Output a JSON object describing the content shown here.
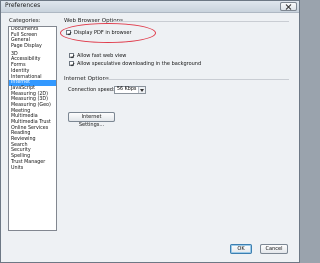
{
  "window": {
    "title": "Preferences"
  },
  "categories": {
    "label": "Categories:",
    "items": [
      {
        "label": "Documents"
      },
      {
        "label": "Full Screen"
      },
      {
        "label": "General"
      },
      {
        "label": "Page Display"
      },
      {
        "label": ""
      },
      {
        "label": "3D"
      },
      {
        "label": "Accessibility"
      },
      {
        "label": "Forms"
      },
      {
        "label": "Identity"
      },
      {
        "label": "International"
      },
      {
        "label": "Internet",
        "selected": true
      },
      {
        "label": "JavaScript"
      },
      {
        "label": "Measuring (2D)"
      },
      {
        "label": "Measuring (3D)"
      },
      {
        "label": "Measuring (Geo)"
      },
      {
        "label": "Meeting"
      },
      {
        "label": "Multimedia"
      },
      {
        "label": "Multimedia Trust"
      },
      {
        "label": "Online Services"
      },
      {
        "label": "Reading"
      },
      {
        "label": "Reviewing"
      },
      {
        "label": "Search"
      },
      {
        "label": "Security"
      },
      {
        "label": "Spelling"
      },
      {
        "label": "Trust Manager"
      },
      {
        "label": "Units"
      }
    ]
  },
  "web_browser_options": {
    "heading": "Web Browser Options",
    "display_pdf": {
      "label": "Display PDF in browser",
      "checked": true
    },
    "fast_web_view": {
      "label": "Allow fast web view",
      "checked": true
    },
    "speculative_downloading": {
      "label": "Allow speculative downloading in the background",
      "checked": true
    }
  },
  "internet_options": {
    "heading": "Internet Options",
    "connection_speed_label": "Connection speed:",
    "connection_speed_value": "56 Kbps",
    "settings_button": "Internet Settings..."
  },
  "footer": {
    "ok_label": "OK",
    "cancel_label": "Cancel"
  },
  "colors": {
    "highlight_circle": "#e03a4a",
    "selection": "#3399ff"
  }
}
